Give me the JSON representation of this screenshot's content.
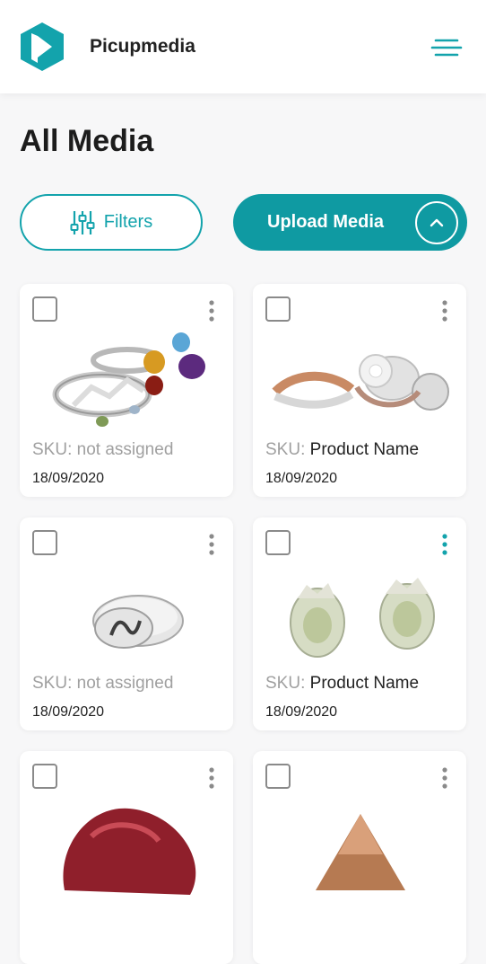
{
  "app": {
    "name": "Picupmedia"
  },
  "page": {
    "title": "All Media"
  },
  "toolbar": {
    "filters_label": "Filters",
    "upload_label": "Upload Media"
  },
  "colors": {
    "accent": "#0f9aa2",
    "accent_light": "#13a3ac",
    "muted_text": "#a0a0a0"
  },
  "icons": {
    "logo": "logo-icon",
    "menu": "hamburger-menu-icon",
    "filters": "sliders-icon",
    "upload_toggle": "chevron-up-icon",
    "more": "kebab-menu-icon"
  },
  "media": [
    {
      "sku_prefix": "SKU:",
      "sku_value": "not assigned",
      "sku_assigned": false,
      "date": "18/09/2020",
      "image": "jewelry-rings-gemstones"
    },
    {
      "sku_prefix": "SKU:",
      "sku_value": "Product Name",
      "sku_assigned": true,
      "date": "18/09/2020",
      "image": "jewelry-diamond-rings"
    },
    {
      "sku_prefix": "SKU:",
      "sku_value": "not assigned",
      "sku_assigned": false,
      "date": "18/09/2020",
      "image": "silver-signet-ring"
    },
    {
      "sku_prefix": "SKU:",
      "sku_value": "Product Name",
      "sku_assigned": true,
      "date": "18/09/2020",
      "image": "green-gem-earrings",
      "menu_active": true
    },
    {
      "image": "red-gemstone"
    },
    {
      "image": "orange-gemstone"
    }
  ]
}
